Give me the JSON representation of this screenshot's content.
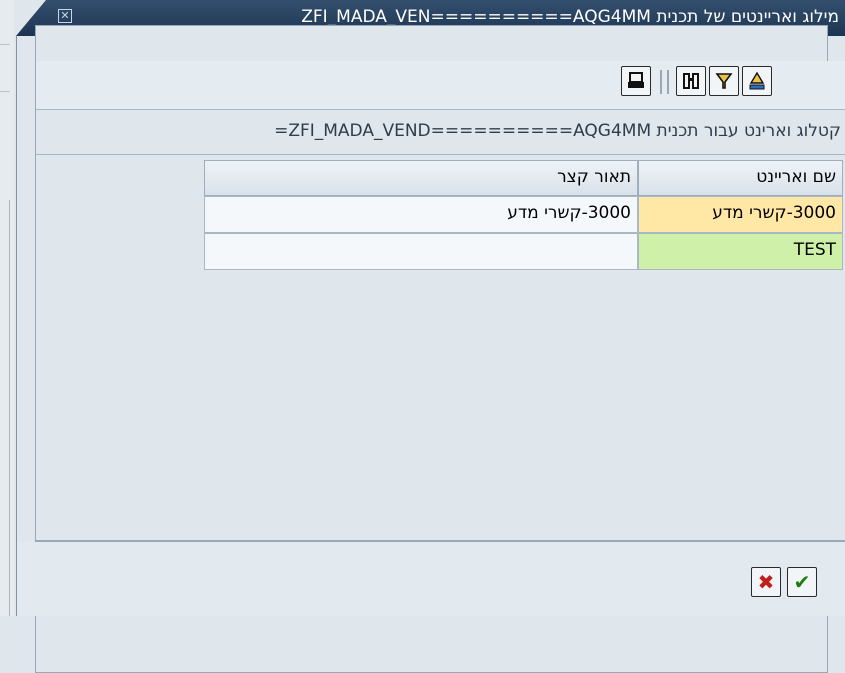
{
  "window": {
    "title": "מילוג ואריינטים של תכנית ZFI_MADA_VEN==========AQG4MM"
  },
  "toolbar": {
    "icons": [
      "print-icon",
      "find-icon",
      "filter-icon",
      "sort-icon"
    ]
  },
  "catalog": {
    "heading": "קטלוג וארינט עבור תכנית ZFI_MADA_VEND==========AQG4MM="
  },
  "table": {
    "headers": {
      "variant_name": "שם ואריינט",
      "short_description": "תאור קצר"
    },
    "rows": [
      {
        "variant_name": "3000-קשרי מדע",
        "short_description": "3000-קשרי מדע"
      },
      {
        "variant_name": "TEST",
        "short_description": ""
      }
    ]
  },
  "colors": {
    "title_bar": "#1c3552",
    "row1_name_bg": "#ffe7a6",
    "row2_name_bg": "#cff0a8",
    "row_bg": "#f4f8fb",
    "cancel_icon": "#c0201a",
    "confirm_icon": "#1e7d12"
  }
}
